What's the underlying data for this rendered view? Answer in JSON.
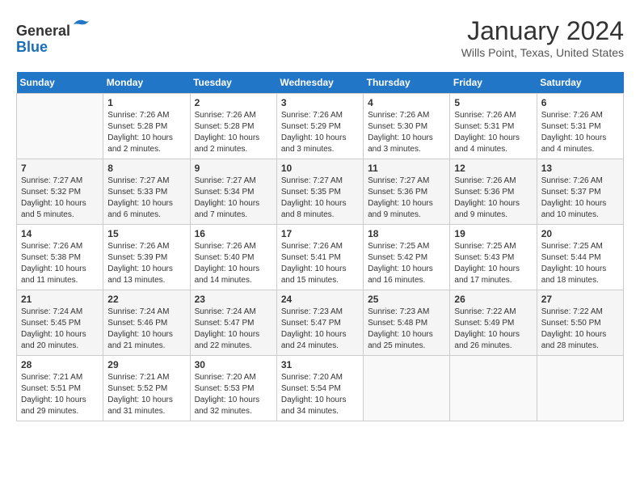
{
  "header": {
    "logo_line1": "General",
    "logo_line2": "Blue",
    "month": "January 2024",
    "location": "Wills Point, Texas, United States"
  },
  "days_of_week": [
    "Sunday",
    "Monday",
    "Tuesday",
    "Wednesday",
    "Thursday",
    "Friday",
    "Saturday"
  ],
  "weeks": [
    [
      {
        "num": "",
        "info": ""
      },
      {
        "num": "1",
        "info": "Sunrise: 7:26 AM\nSunset: 5:28 PM\nDaylight: 10 hours\nand 2 minutes."
      },
      {
        "num": "2",
        "info": "Sunrise: 7:26 AM\nSunset: 5:28 PM\nDaylight: 10 hours\nand 2 minutes."
      },
      {
        "num": "3",
        "info": "Sunrise: 7:26 AM\nSunset: 5:29 PM\nDaylight: 10 hours\nand 3 minutes."
      },
      {
        "num": "4",
        "info": "Sunrise: 7:26 AM\nSunset: 5:30 PM\nDaylight: 10 hours\nand 3 minutes."
      },
      {
        "num": "5",
        "info": "Sunrise: 7:26 AM\nSunset: 5:31 PM\nDaylight: 10 hours\nand 4 minutes."
      },
      {
        "num": "6",
        "info": "Sunrise: 7:26 AM\nSunset: 5:31 PM\nDaylight: 10 hours\nand 4 minutes."
      }
    ],
    [
      {
        "num": "7",
        "info": "Sunrise: 7:27 AM\nSunset: 5:32 PM\nDaylight: 10 hours\nand 5 minutes."
      },
      {
        "num": "8",
        "info": "Sunrise: 7:27 AM\nSunset: 5:33 PM\nDaylight: 10 hours\nand 6 minutes."
      },
      {
        "num": "9",
        "info": "Sunrise: 7:27 AM\nSunset: 5:34 PM\nDaylight: 10 hours\nand 7 minutes."
      },
      {
        "num": "10",
        "info": "Sunrise: 7:27 AM\nSunset: 5:35 PM\nDaylight: 10 hours\nand 8 minutes."
      },
      {
        "num": "11",
        "info": "Sunrise: 7:27 AM\nSunset: 5:36 PM\nDaylight: 10 hours\nand 9 minutes."
      },
      {
        "num": "12",
        "info": "Sunrise: 7:26 AM\nSunset: 5:36 PM\nDaylight: 10 hours\nand 9 minutes."
      },
      {
        "num": "13",
        "info": "Sunrise: 7:26 AM\nSunset: 5:37 PM\nDaylight: 10 hours\nand 10 minutes."
      }
    ],
    [
      {
        "num": "14",
        "info": "Sunrise: 7:26 AM\nSunset: 5:38 PM\nDaylight: 10 hours\nand 11 minutes."
      },
      {
        "num": "15",
        "info": "Sunrise: 7:26 AM\nSunset: 5:39 PM\nDaylight: 10 hours\nand 13 minutes."
      },
      {
        "num": "16",
        "info": "Sunrise: 7:26 AM\nSunset: 5:40 PM\nDaylight: 10 hours\nand 14 minutes."
      },
      {
        "num": "17",
        "info": "Sunrise: 7:26 AM\nSunset: 5:41 PM\nDaylight: 10 hours\nand 15 minutes."
      },
      {
        "num": "18",
        "info": "Sunrise: 7:25 AM\nSunset: 5:42 PM\nDaylight: 10 hours\nand 16 minutes."
      },
      {
        "num": "19",
        "info": "Sunrise: 7:25 AM\nSunset: 5:43 PM\nDaylight: 10 hours\nand 17 minutes."
      },
      {
        "num": "20",
        "info": "Sunrise: 7:25 AM\nSunset: 5:44 PM\nDaylight: 10 hours\nand 18 minutes."
      }
    ],
    [
      {
        "num": "21",
        "info": "Sunrise: 7:24 AM\nSunset: 5:45 PM\nDaylight: 10 hours\nand 20 minutes."
      },
      {
        "num": "22",
        "info": "Sunrise: 7:24 AM\nSunset: 5:46 PM\nDaylight: 10 hours\nand 21 minutes."
      },
      {
        "num": "23",
        "info": "Sunrise: 7:24 AM\nSunset: 5:47 PM\nDaylight: 10 hours\nand 22 minutes."
      },
      {
        "num": "24",
        "info": "Sunrise: 7:23 AM\nSunset: 5:47 PM\nDaylight: 10 hours\nand 24 minutes."
      },
      {
        "num": "25",
        "info": "Sunrise: 7:23 AM\nSunset: 5:48 PM\nDaylight: 10 hours\nand 25 minutes."
      },
      {
        "num": "26",
        "info": "Sunrise: 7:22 AM\nSunset: 5:49 PM\nDaylight: 10 hours\nand 26 minutes."
      },
      {
        "num": "27",
        "info": "Sunrise: 7:22 AM\nSunset: 5:50 PM\nDaylight: 10 hours\nand 28 minutes."
      }
    ],
    [
      {
        "num": "28",
        "info": "Sunrise: 7:21 AM\nSunset: 5:51 PM\nDaylight: 10 hours\nand 29 minutes."
      },
      {
        "num": "29",
        "info": "Sunrise: 7:21 AM\nSunset: 5:52 PM\nDaylight: 10 hours\nand 31 minutes."
      },
      {
        "num": "30",
        "info": "Sunrise: 7:20 AM\nSunset: 5:53 PM\nDaylight: 10 hours\nand 32 minutes."
      },
      {
        "num": "31",
        "info": "Sunrise: 7:20 AM\nSunset: 5:54 PM\nDaylight: 10 hours\nand 34 minutes."
      },
      {
        "num": "",
        "info": ""
      },
      {
        "num": "",
        "info": ""
      },
      {
        "num": "",
        "info": ""
      }
    ]
  ]
}
